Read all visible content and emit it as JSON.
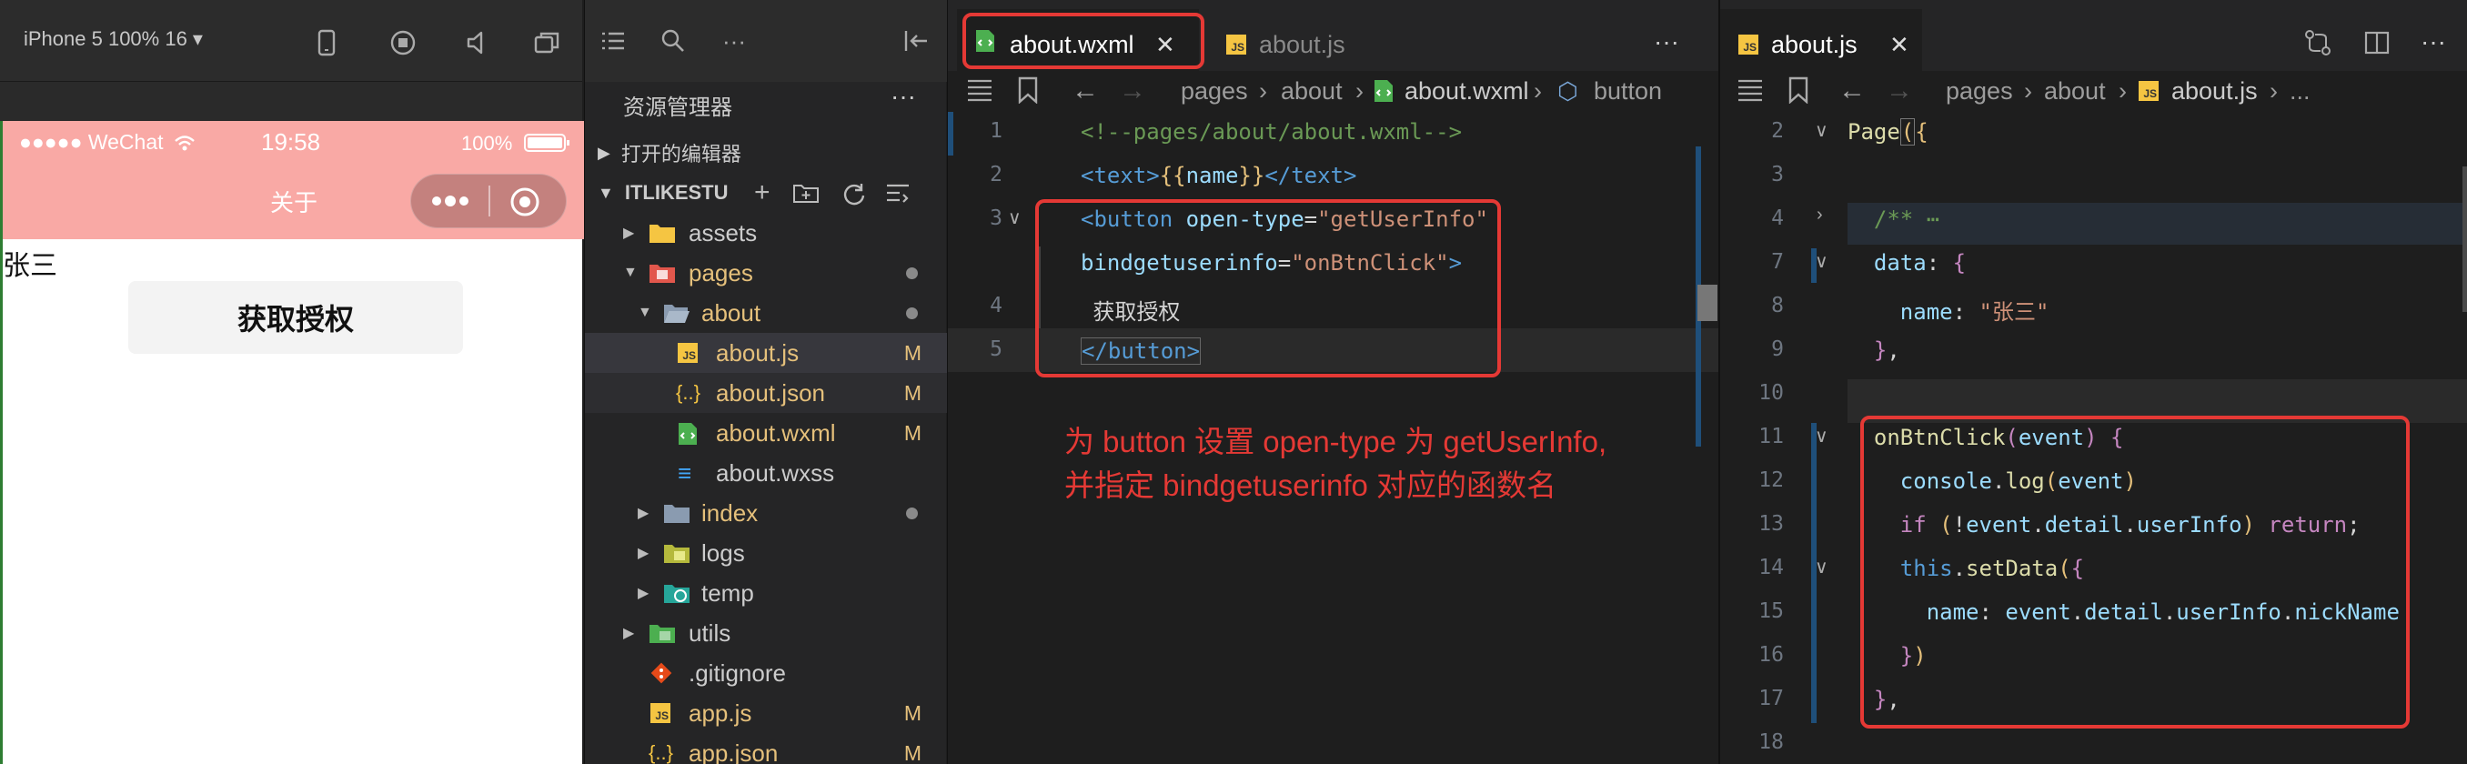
{
  "simulator": {
    "device_label": "iPhone 5 100% 16 ▾",
    "status_carrier": "●●●●● WeChat",
    "status_time": "19:58",
    "status_battery": "100%",
    "nav_title": "关于",
    "page_name_text": "张三",
    "auth_button": "获取授权"
  },
  "explorer": {
    "title": "资源管理器",
    "open_editors": "打开的编辑器",
    "project": "ITLIKESTU",
    "tree": [
      {
        "label": "assets",
        "badge": ""
      },
      {
        "label": "pages",
        "badge": "dot"
      },
      {
        "label": "about",
        "badge": "dot"
      },
      {
        "label": "about.js",
        "badge": "M"
      },
      {
        "label": "about.json",
        "badge": "M"
      },
      {
        "label": "about.wxml",
        "badge": "M"
      },
      {
        "label": "about.wxss",
        "badge": ""
      },
      {
        "label": "index",
        "badge": "dot"
      },
      {
        "label": "logs",
        "badge": ""
      },
      {
        "label": "temp",
        "badge": ""
      },
      {
        "label": "utils",
        "badge": ""
      },
      {
        "label": ".gitignore",
        "badge": ""
      },
      {
        "label": "app.js",
        "badge": "M"
      },
      {
        "label": "app.json",
        "badge": "M"
      }
    ]
  },
  "editor_left": {
    "tabs": [
      "about.wxml",
      "about.js"
    ],
    "breadcrumb": [
      "pages",
      "about",
      "about.wxml",
      "button"
    ],
    "line_numbers": [
      "1",
      "2",
      "3",
      "",
      "4",
      "5"
    ],
    "lines": [
      "<!--pages/about/about.wxml-->",
      "<text>{{name}}</text>",
      "<button open-type=\"getUserInfo\"",
      "bindgetuserinfo=\"onBtnClick\">",
      "  获取授权",
      "</button>"
    ],
    "annotation_line1": "为 button 设置 open-type 为  getUserInfo,",
    "annotation_line2": "并指定 bindgetuserinfo 对应的函数名"
  },
  "editor_right": {
    "tab": "about.js",
    "breadcrumb": [
      "pages",
      "about",
      "about.js",
      "..."
    ],
    "line_numbers": [
      "2",
      "3",
      "4",
      "7",
      "8",
      "9",
      "10",
      "11",
      "12",
      "13",
      "14",
      "15",
      "16",
      "17",
      "18"
    ],
    "lines": [
      "Page({",
      "",
      "  /** ⋯",
      "  data: {",
      "    name: \"张三\"",
      "  },",
      "",
      "  onBtnClick(event) {",
      "    console.log(event)",
      "    if (!event.detail.userInfo) return;",
      "    this.setData({",
      "      name: event.detail.userInfo.nickName",
      "    })",
      "  },",
      ""
    ]
  },
  "colors": {
    "accent_red": "#e53935",
    "nav_pink": "#f9a9a5",
    "tag_blue": "#569cd6",
    "attr_blue": "#9cdcfe",
    "string_orange": "#ce9178",
    "comment_green": "#6a9955",
    "func_yellow": "#dcdcaa",
    "keyword_purple": "#c586c0"
  }
}
